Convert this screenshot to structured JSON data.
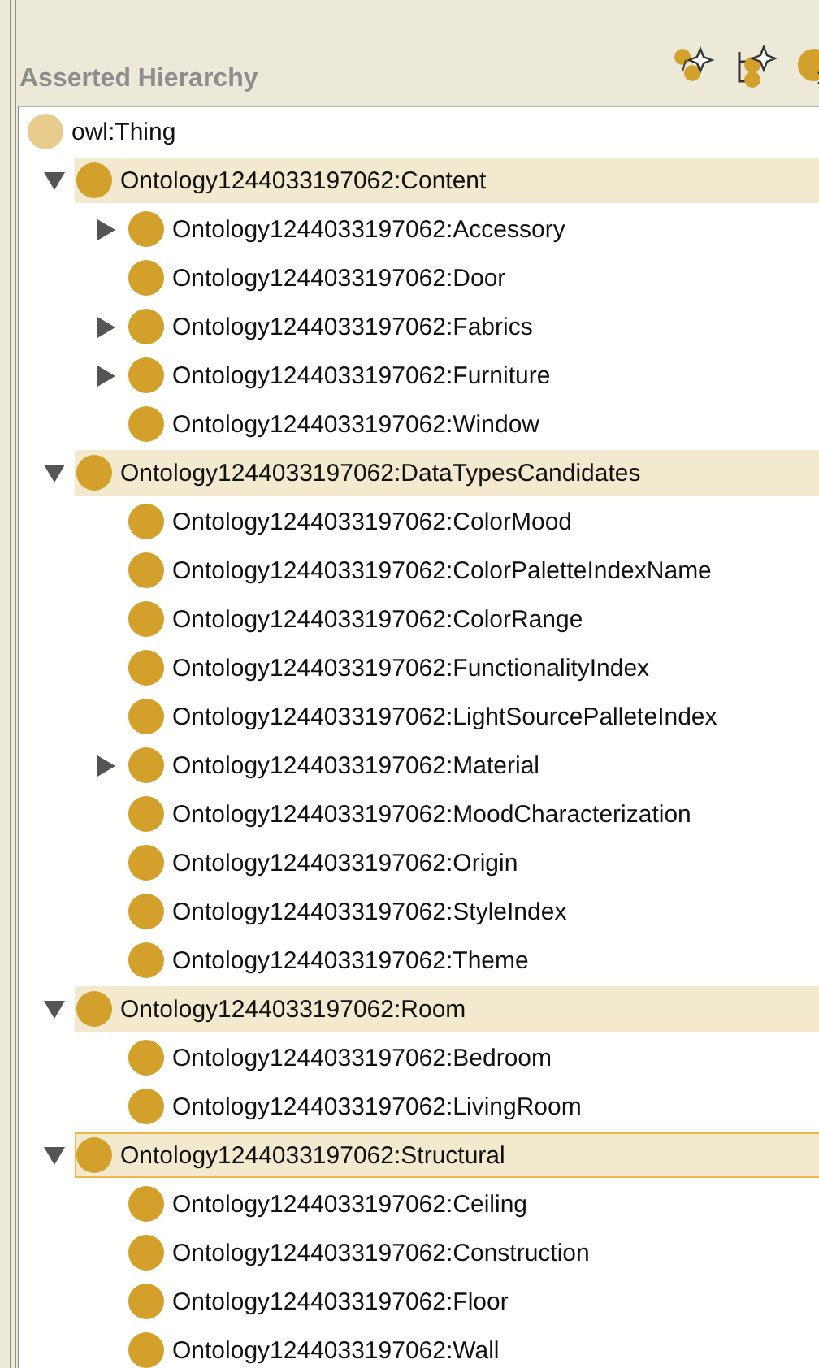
{
  "panel": {
    "title": "Asserted Hierarchy"
  },
  "tree": {
    "root": {
      "label": "owl:Thing",
      "selected": false,
      "highlighted": false,
      "children": [
        {
          "label": "Ontology1244033197062:Content",
          "selected": false,
          "highlighted": true,
          "expanded": true,
          "children": [
            {
              "label": "Ontology1244033197062:Accessory",
              "selected": false,
              "highlighted": false,
              "expanded": false
            },
            {
              "label": "Ontology1244033197062:Door",
              "selected": false,
              "highlighted": false
            },
            {
              "label": "Ontology1244033197062:Fabrics",
              "selected": false,
              "highlighted": false,
              "expanded": false
            },
            {
              "label": "Ontology1244033197062:Furniture",
              "selected": false,
              "highlighted": false,
              "expanded": false
            },
            {
              "label": "Ontology1244033197062:Window",
              "selected": false,
              "highlighted": false
            }
          ]
        },
        {
          "label": "Ontology1244033197062:DataTypesCandidates",
          "selected": false,
          "highlighted": true,
          "expanded": true,
          "children": [
            {
              "label": "Ontology1244033197062:ColorMood",
              "selected": false,
              "highlighted": false
            },
            {
              "label": "Ontology1244033197062:ColorPaletteIndexName",
              "selected": false,
              "highlighted": false
            },
            {
              "label": "Ontology1244033197062:ColorRange",
              "selected": false,
              "highlighted": false
            },
            {
              "label": "Ontology1244033197062:FunctionalityIndex",
              "selected": false,
              "highlighted": false
            },
            {
              "label": "Ontology1244033197062:LightSourcePalleteIndex",
              "selected": false,
              "highlighted": false
            },
            {
              "label": "Ontology1244033197062:Material",
              "selected": false,
              "highlighted": false,
              "expanded": false
            },
            {
              "label": "Ontology1244033197062:MoodCharacterization",
              "selected": false,
              "highlighted": false
            },
            {
              "label": "Ontology1244033197062:Origin",
              "selected": false,
              "highlighted": false
            },
            {
              "label": "Ontology1244033197062:StyleIndex",
              "selected": false,
              "highlighted": false
            },
            {
              "label": "Ontology1244033197062:Theme",
              "selected": false,
              "highlighted": false
            }
          ]
        },
        {
          "label": "Ontology1244033197062:Room",
          "selected": false,
          "highlighted": true,
          "expanded": true,
          "children": [
            {
              "label": "Ontology1244033197062:Bedroom",
              "selected": false,
              "highlighted": false
            },
            {
              "label": "Ontology1244033197062:LivingRoom",
              "selected": false,
              "highlighted": false
            }
          ]
        },
        {
          "label": "Ontology1244033197062:Structural",
          "selected": true,
          "highlighted": true,
          "expanded": true,
          "children": [
            {
              "label": "Ontology1244033197062:Ceiling",
              "selected": false,
              "highlighted": false
            },
            {
              "label": "Ontology1244033197062:Construction",
              "selected": false,
              "highlighted": false
            },
            {
              "label": "Ontology1244033197062:Floor",
              "selected": false,
              "highlighted": false
            },
            {
              "label": "Ontology1244033197062:Wall",
              "selected": false,
              "highlighted": false
            }
          ]
        }
      ]
    }
  }
}
